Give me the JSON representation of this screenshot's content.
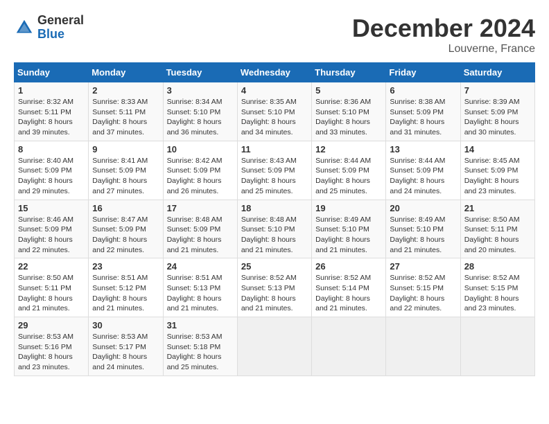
{
  "header": {
    "logo_general": "General",
    "logo_blue": "Blue",
    "month_title": "December 2024",
    "location": "Louverne, France"
  },
  "weekdays": [
    "Sunday",
    "Monday",
    "Tuesday",
    "Wednesday",
    "Thursday",
    "Friday",
    "Saturday"
  ],
  "weeks": [
    [
      {
        "day": "1",
        "sunrise": "8:32 AM",
        "sunset": "5:11 PM",
        "daylight": "8 hours and 39 minutes."
      },
      {
        "day": "2",
        "sunrise": "8:33 AM",
        "sunset": "5:11 PM",
        "daylight": "8 hours and 37 minutes."
      },
      {
        "day": "3",
        "sunrise": "8:34 AM",
        "sunset": "5:10 PM",
        "daylight": "8 hours and 36 minutes."
      },
      {
        "day": "4",
        "sunrise": "8:35 AM",
        "sunset": "5:10 PM",
        "daylight": "8 hours and 34 minutes."
      },
      {
        "day": "5",
        "sunrise": "8:36 AM",
        "sunset": "5:10 PM",
        "daylight": "8 hours and 33 minutes."
      },
      {
        "day": "6",
        "sunrise": "8:38 AM",
        "sunset": "5:09 PM",
        "daylight": "8 hours and 31 minutes."
      },
      {
        "day": "7",
        "sunrise": "8:39 AM",
        "sunset": "5:09 PM",
        "daylight": "8 hours and 30 minutes."
      }
    ],
    [
      {
        "day": "8",
        "sunrise": "8:40 AM",
        "sunset": "5:09 PM",
        "daylight": "8 hours and 29 minutes."
      },
      {
        "day": "9",
        "sunrise": "8:41 AM",
        "sunset": "5:09 PM",
        "daylight": "8 hours and 27 minutes."
      },
      {
        "day": "10",
        "sunrise": "8:42 AM",
        "sunset": "5:09 PM",
        "daylight": "8 hours and 26 minutes."
      },
      {
        "day": "11",
        "sunrise": "8:43 AM",
        "sunset": "5:09 PM",
        "daylight": "8 hours and 25 minutes."
      },
      {
        "day": "12",
        "sunrise": "8:44 AM",
        "sunset": "5:09 PM",
        "daylight": "8 hours and 25 minutes."
      },
      {
        "day": "13",
        "sunrise": "8:44 AM",
        "sunset": "5:09 PM",
        "daylight": "8 hours and 24 minutes."
      },
      {
        "day": "14",
        "sunrise": "8:45 AM",
        "sunset": "5:09 PM",
        "daylight": "8 hours and 23 minutes."
      }
    ],
    [
      {
        "day": "15",
        "sunrise": "8:46 AM",
        "sunset": "5:09 PM",
        "daylight": "8 hours and 22 minutes."
      },
      {
        "day": "16",
        "sunrise": "8:47 AM",
        "sunset": "5:09 PM",
        "daylight": "8 hours and 22 minutes."
      },
      {
        "day": "17",
        "sunrise": "8:48 AM",
        "sunset": "5:09 PM",
        "daylight": "8 hours and 21 minutes."
      },
      {
        "day": "18",
        "sunrise": "8:48 AM",
        "sunset": "5:10 PM",
        "daylight": "8 hours and 21 minutes."
      },
      {
        "day": "19",
        "sunrise": "8:49 AM",
        "sunset": "5:10 PM",
        "daylight": "8 hours and 21 minutes."
      },
      {
        "day": "20",
        "sunrise": "8:49 AM",
        "sunset": "5:10 PM",
        "daylight": "8 hours and 21 minutes."
      },
      {
        "day": "21",
        "sunrise": "8:50 AM",
        "sunset": "5:11 PM",
        "daylight": "8 hours and 20 minutes."
      }
    ],
    [
      {
        "day": "22",
        "sunrise": "8:50 AM",
        "sunset": "5:11 PM",
        "daylight": "8 hours and 21 minutes."
      },
      {
        "day": "23",
        "sunrise": "8:51 AM",
        "sunset": "5:12 PM",
        "daylight": "8 hours and 21 minutes."
      },
      {
        "day": "24",
        "sunrise": "8:51 AM",
        "sunset": "5:13 PM",
        "daylight": "8 hours and 21 minutes."
      },
      {
        "day": "25",
        "sunrise": "8:52 AM",
        "sunset": "5:13 PM",
        "daylight": "8 hours and 21 minutes."
      },
      {
        "day": "26",
        "sunrise": "8:52 AM",
        "sunset": "5:14 PM",
        "daylight": "8 hours and 21 minutes."
      },
      {
        "day": "27",
        "sunrise": "8:52 AM",
        "sunset": "5:15 PM",
        "daylight": "8 hours and 22 minutes."
      },
      {
        "day": "28",
        "sunrise": "8:52 AM",
        "sunset": "5:15 PM",
        "daylight": "8 hours and 23 minutes."
      }
    ],
    [
      {
        "day": "29",
        "sunrise": "8:53 AM",
        "sunset": "5:16 PM",
        "daylight": "8 hours and 23 minutes."
      },
      {
        "day": "30",
        "sunrise": "8:53 AM",
        "sunset": "5:17 PM",
        "daylight": "8 hours and 24 minutes."
      },
      {
        "day": "31",
        "sunrise": "8:53 AM",
        "sunset": "5:18 PM",
        "daylight": "8 hours and 25 minutes."
      },
      null,
      null,
      null,
      null
    ]
  ]
}
